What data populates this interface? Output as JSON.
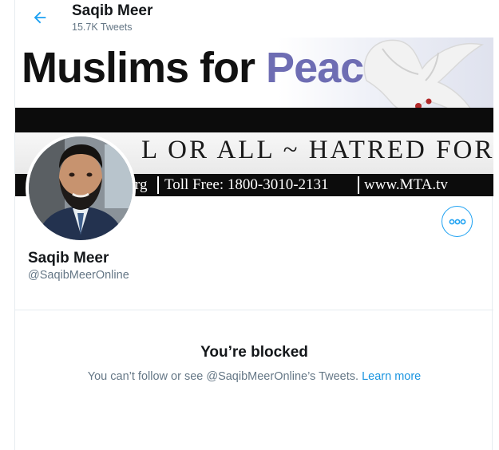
{
  "header": {
    "name": "Saqib Meer",
    "tweet_count": "15.7K Tweets",
    "back_icon": "arrow-left-icon"
  },
  "banner": {
    "title_part1": "Muslims for ",
    "title_part2": "Peace",
    "motto": "LOVE FOR ALL ~ HATRED FOR NONE",
    "visible_motto": "L      OR ALL ~ HATRED FOR NONE",
    "footer_left": "rg",
    "footer_phone": "Toll Free: 1800-3010-2131",
    "footer_site": "www.MTA.tv",
    "accent_color": "#6e6db3"
  },
  "profile": {
    "name": "Saqib Meer",
    "handle": "@SaqibMeerOnline",
    "more_icon": "more-dots-icon"
  },
  "blocked": {
    "title": "You’re blocked",
    "message": "You can’t follow or see @SaqibMeerOnline’s Tweets. ",
    "learn_more": "Learn more"
  },
  "colors": {
    "brand_blue": "#1da1f2",
    "link_blue": "#1b95e0",
    "secondary_text": "#657786"
  }
}
